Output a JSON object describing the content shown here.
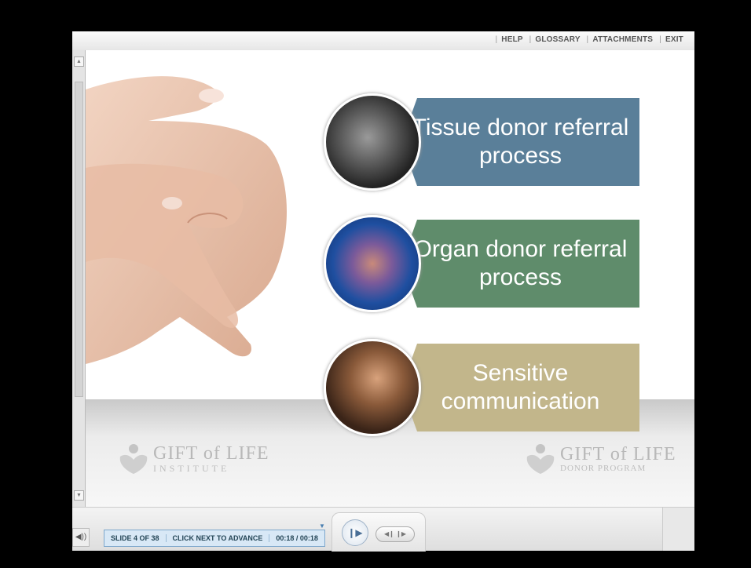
{
  "header": {
    "links": [
      "HELP",
      "GLOSSARY",
      "ATTACHMENTS",
      "EXIT"
    ]
  },
  "slide": {
    "items": [
      {
        "text": "Tissue donor referral process",
        "color": "#5a7f99",
        "icon": "xray-image"
      },
      {
        "text": "Organ donor referral process",
        "color": "#5f8c6b",
        "icon": "organs-image"
      },
      {
        "text": "Sensitive communication",
        "color": "#c2b68b",
        "icon": "people-image"
      }
    ],
    "logo_left": {
      "name": "GIFT of LIFE",
      "sub": "INSTITUTE"
    },
    "logo_right": {
      "name": "GIFT of LIFE",
      "sub": "DONOR PROGRAM"
    }
  },
  "controls": {
    "slide_count": "SLIDE 4 OF 38",
    "advance_hint": "CLICK NEXT TO ADVANCE",
    "time": "00:18 / 00:18"
  }
}
